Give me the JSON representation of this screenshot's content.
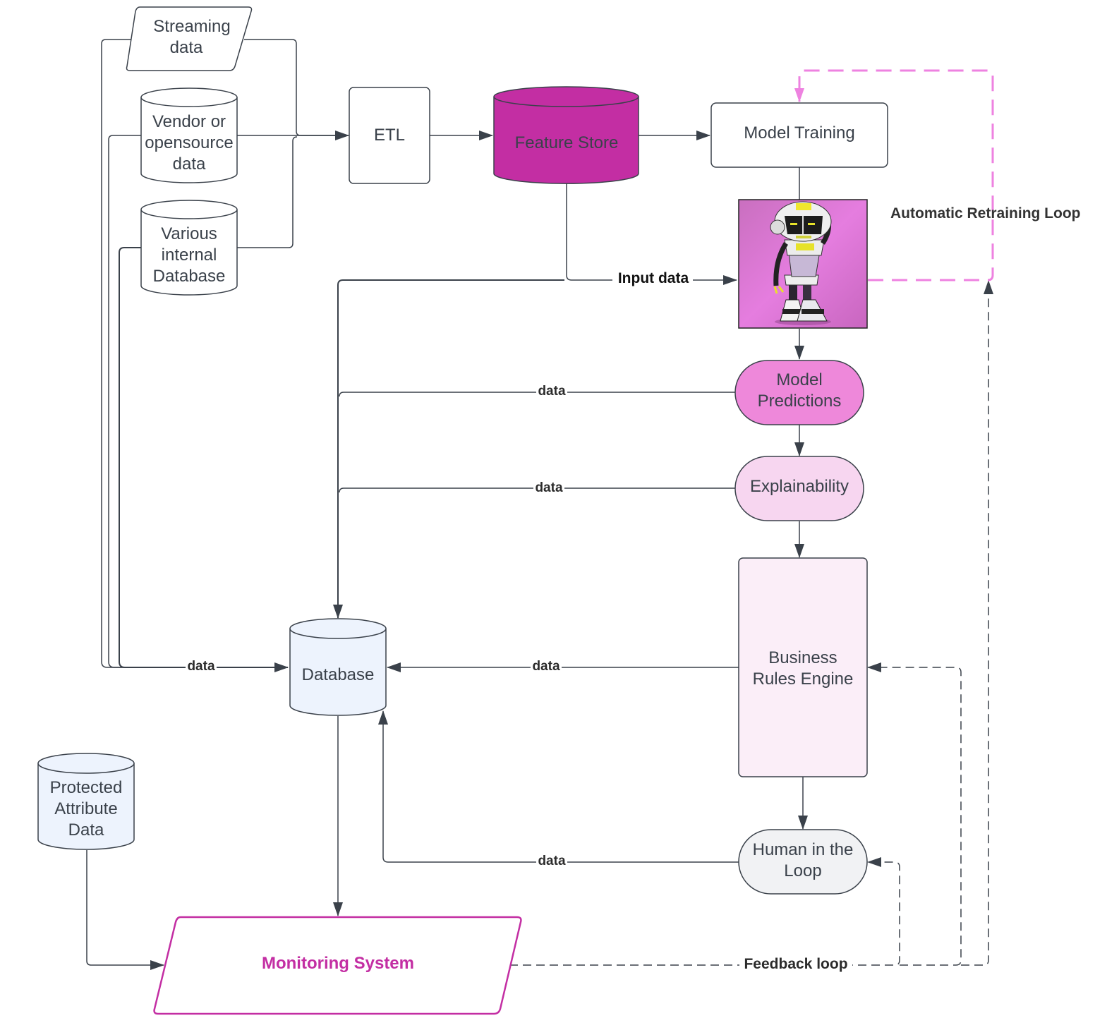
{
  "diagram": {
    "nodes": {
      "streaming": {
        "line1": "Streaming",
        "line2": "data"
      },
      "vendor": {
        "line1": "Vendor or",
        "line2": "opensource",
        "line3": "data"
      },
      "internal": {
        "line1": "Various",
        "line2": "internal",
        "line3": "Database"
      },
      "etl": {
        "label": "ETL"
      },
      "feature_store": {
        "label": "Feature Store"
      },
      "model_training": {
        "label": "Model Training"
      },
      "model_image": {
        "label": "robot model illustration"
      },
      "predictions": {
        "line1": "Model",
        "line2": "Predictions"
      },
      "explainability": {
        "label": "Explainability"
      },
      "business_rules": {
        "line1": "Business",
        "line2": "Rules Engine"
      },
      "human_loop": {
        "line1": "Human in the",
        "line2": "Loop"
      },
      "database": {
        "label": "Database"
      },
      "protected": {
        "line1": "Protected",
        "line2": "Attribute",
        "line3": "Data"
      },
      "monitoring": {
        "label": "Monitoring System"
      }
    },
    "edge_labels": {
      "input_data": "Input data",
      "predictions_data": "data",
      "explain_data": "data",
      "sources_data": "data",
      "rules_data": "data",
      "human_data": "data",
      "feedback": "Feedback loop",
      "retraining": "Automatic Retraining Loop"
    },
    "colors": {
      "feature_store": "#c32ea3",
      "predictions": "#ee88da",
      "explainability": "#f7d6f0",
      "business_rules": "#fbeef8",
      "human_loop": "#f1f2f4",
      "database": "#edf3fd",
      "monitoring_accent": "#c32ea3",
      "retraining_loop": "#ee82e0",
      "line": "#3a414a"
    }
  }
}
